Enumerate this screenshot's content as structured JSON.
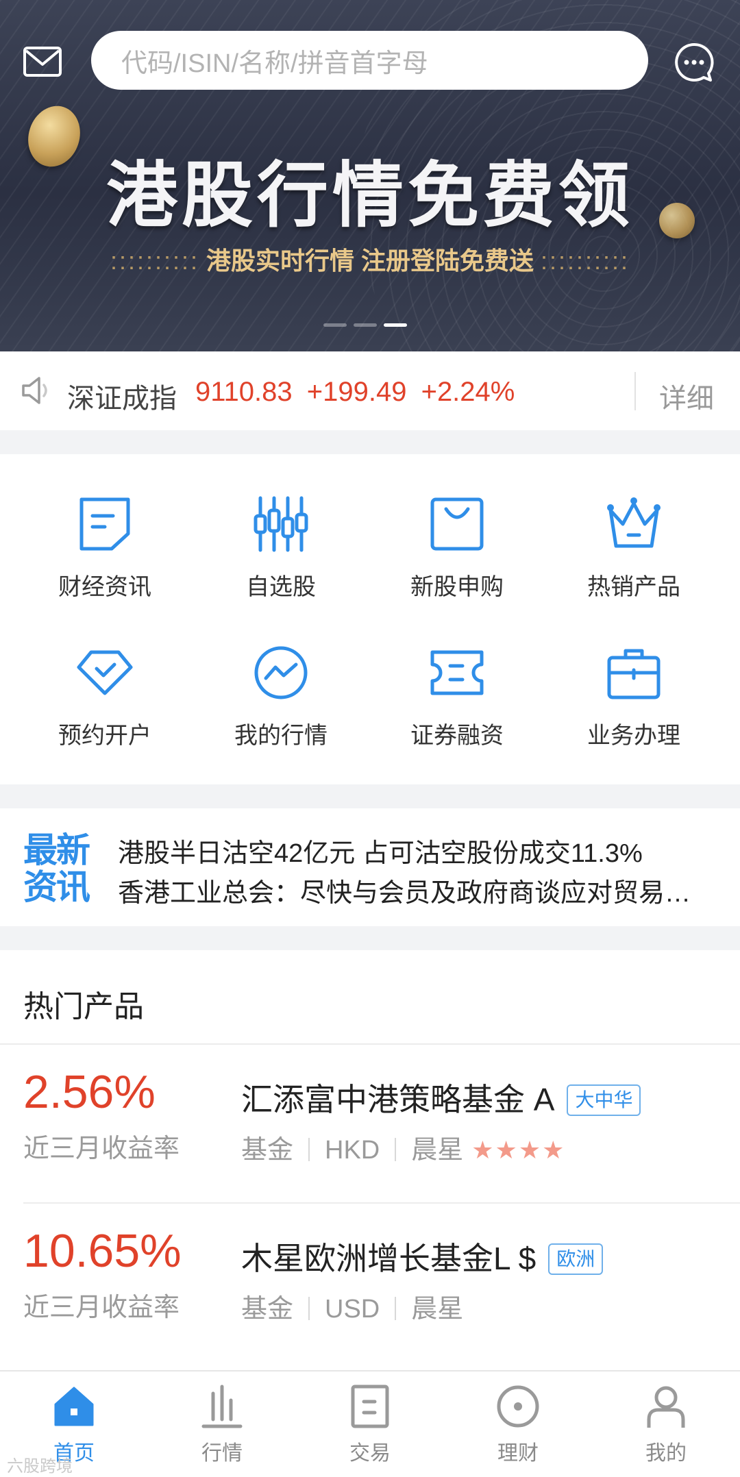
{
  "header": {
    "search_placeholder": "代码/ISIN/名称/拼音首字母"
  },
  "banner": {
    "title": "港股行情免费领",
    "subtitle_dots_left": "::::::::::",
    "subtitle": "港股实时行情  注册登陆免费送",
    "subtitle_dots_right": "::::::::::",
    "page_count": 3,
    "active_page": 3
  },
  "ticker": {
    "index_name": "深证成指",
    "value": "9110.83",
    "change": "+199.49",
    "change_pct": "+2.24%",
    "detail_label": "详细"
  },
  "menu": {
    "items": [
      {
        "label": "财经资讯",
        "icon": "news-doc-icon"
      },
      {
        "label": "自选股",
        "icon": "candlestick-icon"
      },
      {
        "label": "新股申购",
        "icon": "shopping-bag-icon"
      },
      {
        "label": "热销产品",
        "icon": "crown-icon"
      },
      {
        "label": "预约开户",
        "icon": "check-tag-icon"
      },
      {
        "label": "我的行情",
        "icon": "trend-circle-icon"
      },
      {
        "label": "证券融资",
        "icon": "ticket-icon"
      },
      {
        "label": "业务办理",
        "icon": "briefcase-icon"
      }
    ]
  },
  "news": {
    "tag_line1": "最新",
    "tag_line2": "资讯",
    "headline1": "港股半日沽空42亿元  占可沽空股份成交11.3%",
    "headline2": "香港工业总会：尽快与会员及政府商谈应对贸易战的措施"
  },
  "hot": {
    "title": "热门产品",
    "products": [
      {
        "rate": "2.56%",
        "rate_label": "近三月收益率",
        "name": "汇添富中港策略基金 A",
        "badge": "大中华",
        "type": "基金",
        "currency": "HKD",
        "rating_source": "晨星",
        "rating_stars": "★★★★",
        "rating_value": 4
      },
      {
        "rate": "10.65%",
        "rate_label": "近三月收益率",
        "name": "木星欧洲增长基金L $",
        "badge": "欧洲",
        "type": "基金",
        "currency": "USD",
        "rating_source": "晨星"
      }
    ]
  },
  "tabbar": {
    "tabs": [
      {
        "label": "首页",
        "icon": "home-icon",
        "active": true
      },
      {
        "label": "行情",
        "icon": "bar-chart-icon",
        "active": false
      },
      {
        "label": "交易",
        "icon": "trade-doc-icon",
        "active": false
      },
      {
        "label": "理财",
        "icon": "wealth-circle-icon",
        "active": false
      },
      {
        "label": "我的",
        "icon": "user-icon",
        "active": false
      }
    ]
  },
  "watermark": "六股跨境",
  "colors": {
    "accent": "#2f8ee8",
    "rise": "#e0422a",
    "banner_gold": "#e9c88a"
  }
}
